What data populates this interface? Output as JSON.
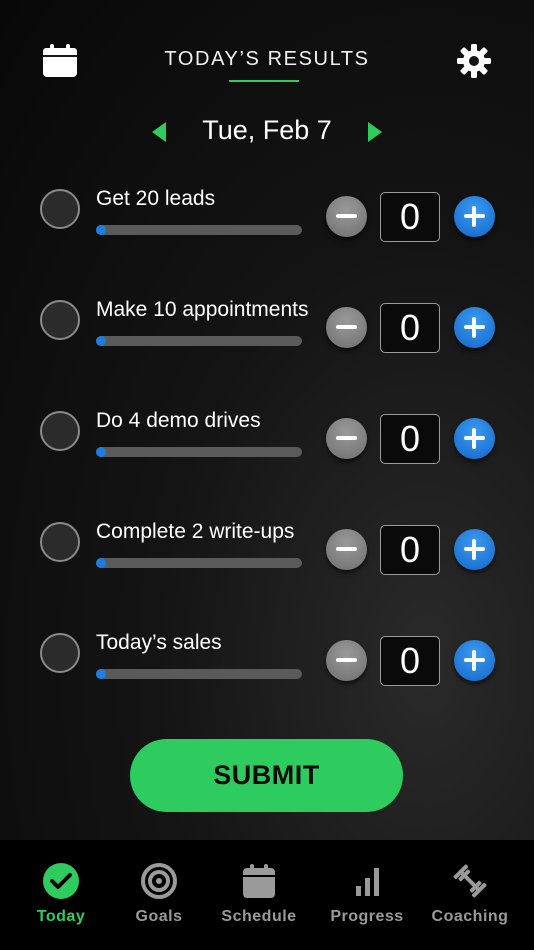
{
  "header": {
    "title": "TODAY’S RESULTS",
    "calendar_icon": "calendar-icon",
    "settings_icon": "gear-icon",
    "accent": "#2ecc5f"
  },
  "date_nav": {
    "date": "Tue, Feb 7",
    "prev_icon": "triangle-left-icon",
    "next_icon": "triangle-right-icon"
  },
  "goals": [
    {
      "label": "Get 20 leads",
      "count": "0",
      "progress": 0
    },
    {
      "label": "Make 10 appointments",
      "count": "0",
      "progress": 0
    },
    {
      "label": "Do 4 demo drives",
      "count": "0",
      "progress": 0
    },
    {
      "label": "Complete 2 write-ups",
      "count": "0",
      "progress": 0
    },
    {
      "label": "Today’s sales",
      "count": "0",
      "progress": 0
    }
  ],
  "submit_label": "SUBMIT",
  "tabs": [
    {
      "label": "Today",
      "icon": "check-circle-icon",
      "active": true
    },
    {
      "label": "Goals",
      "icon": "target-icon",
      "active": false
    },
    {
      "label": "Schedule",
      "icon": "calendar-icon",
      "active": false
    },
    {
      "label": "Progress",
      "icon": "bar-chart-icon",
      "active": false
    },
    {
      "label": "Coaching",
      "icon": "dumbbell-icon",
      "active": false
    }
  ],
  "colors": {
    "accent_green": "#2ecc5f",
    "plus_blue": "#1b7ee0",
    "minus_gray": "#7a7a7a",
    "inactive_tab": "#9a9a9a"
  }
}
